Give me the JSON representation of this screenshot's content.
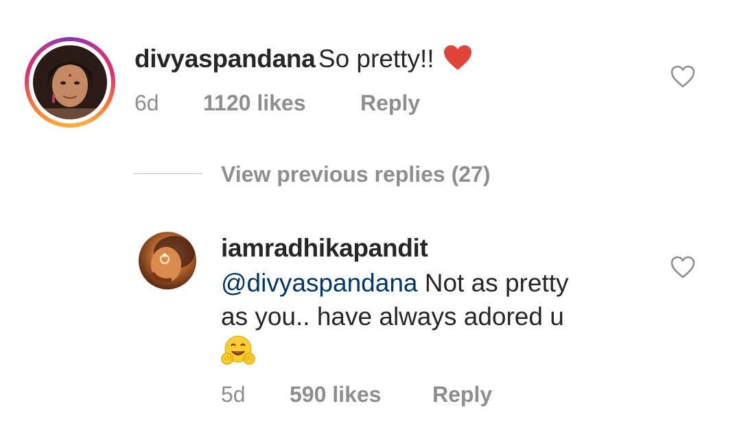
{
  "comment1": {
    "username": "divyaspandana",
    "text": "So pretty!!",
    "emoji": "❤",
    "time": "6d",
    "likes": "1120 likes",
    "reply_label": "Reply"
  },
  "view_replies": {
    "label": "View previous replies (27)"
  },
  "comment2": {
    "username": "iamradhikapandit",
    "mention": "@divyaspandana",
    "line1_rest": " Not as pretty",
    "line2": "as you.. have always adored u",
    "emoji": "🤗",
    "time": "5d",
    "likes": "590 likes",
    "reply_label": "Reply"
  },
  "icons": {
    "like": "heart-outline-icon",
    "red_heart": "red-heart-emoji-icon",
    "hug": "hugging-face-emoji-icon"
  },
  "colors": {
    "text": "#262626",
    "secondary": "#8e8e8e",
    "mention": "#003569",
    "heart_red": "#ed4956"
  }
}
